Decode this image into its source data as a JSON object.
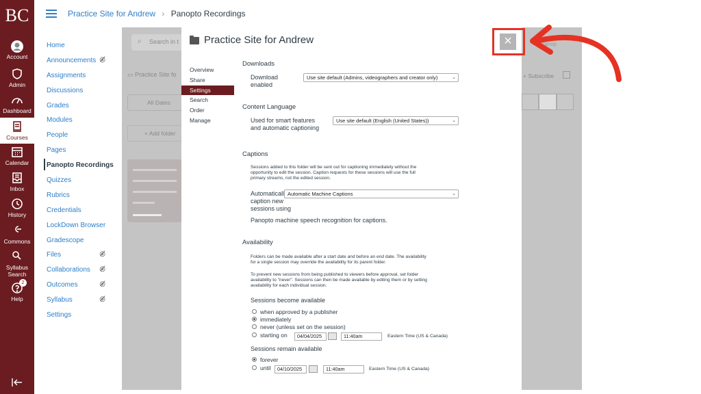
{
  "global_nav": {
    "logo": "BC",
    "items": [
      {
        "label": "Account",
        "icon": "account-icon"
      },
      {
        "label": "Admin",
        "icon": "admin-shield-icon"
      },
      {
        "label": "Dashboard",
        "icon": "dashboard-icon"
      },
      {
        "label": "Courses",
        "icon": "courses-icon"
      },
      {
        "label": "Calendar",
        "icon": "calendar-icon"
      },
      {
        "label": "Inbox",
        "icon": "inbox-icon"
      },
      {
        "label": "History",
        "icon": "history-clock-icon"
      },
      {
        "label": "Commons",
        "icon": "commons-icon"
      },
      {
        "label_line1": "Syllabus",
        "label_line2": "Search",
        "icon": "syllabus-search-icon"
      },
      {
        "label": "Help",
        "icon": "help-icon",
        "badge": "2"
      }
    ],
    "collapse_icon": "collapse-nav-icon"
  },
  "breadcrumb": {
    "course": "Practice Site for Andrew",
    "separator": "›",
    "current": "Panopto Recordings"
  },
  "course_nav": {
    "items": [
      {
        "label": "Home"
      },
      {
        "label": "Announcements",
        "hidden": true
      },
      {
        "label": "Assignments"
      },
      {
        "label": "Discussions"
      },
      {
        "label": "Grades"
      },
      {
        "label": "Modules"
      },
      {
        "label": "People"
      },
      {
        "label": "Pages"
      },
      {
        "label": "Panopto Recordings",
        "active": true
      },
      {
        "label": "Quizzes"
      },
      {
        "label": "Rubrics"
      },
      {
        "label": "Credentials"
      },
      {
        "label": "LockDown Browser"
      },
      {
        "label": "Gradescope"
      },
      {
        "label": "Files",
        "hidden": true
      },
      {
        "label": "Collaborations",
        "hidden": true
      },
      {
        "label": "Outcomes",
        "hidden": true
      },
      {
        "label": "Syllabus",
        "hidden": true
      },
      {
        "label": "Settings"
      }
    ]
  },
  "background": {
    "search_placeholder": "Search in t",
    "folder_label": "Practice Site fo",
    "dates_label": "All Dates",
    "add_folder": "Add folder",
    "subscribe": "Subscribe",
    "user_text": "Panop"
  },
  "modal": {
    "title": "Practice Site for Andrew",
    "close_symbol": "×",
    "nav": [
      "Overview",
      "Share",
      "Settings",
      "Search",
      "Order",
      "Manage"
    ],
    "active_nav": "Settings",
    "downloads": {
      "title": "Downloads",
      "label_line1": "Download",
      "label_line2": "enabled",
      "value": "Use site default (Admins, videographers and creator only)"
    },
    "content_language": {
      "title": "Content Language",
      "label_line1": "Used for smart features",
      "label_line2": "and automatic captioning",
      "value": "Use site default (English (United States))"
    },
    "captions": {
      "title": "Captions",
      "description_line1": "Sessions added to this folder will be sent out for captioning immediately without the",
      "description_line2": "opportunity to edit the session. Caption requests for these sessions will use the full",
      "description_line3": "primary streams, not the edited session.",
      "label_line1": "Automatically",
      "label_line2": "caption new",
      "label_line3": "sessions using",
      "value": "Automatic Machine Captions",
      "note": "Panopto machine speech recognition for captions."
    },
    "availability": {
      "title": "Availability",
      "p1_line1": "Folders can be made available after a start date and before an end date. The availability",
      "p1_line2": "for a single session may override the availability for its parent folder.",
      "p2_line1": "To prevent new sessions from being published to viewers before approval, set folder",
      "p2_line2": "availability to \"never\". Sessions can then be made available by editing them or by setting",
      "p2_line3": "availability for each individual session.",
      "become_title": "Sessions become available",
      "become_options": [
        {
          "label": "when approved by a publisher",
          "selected": false
        },
        {
          "label": "immediately",
          "selected": true
        },
        {
          "label": "never (unless set on the session)",
          "selected": false
        },
        {
          "label": "starting on",
          "selected": false
        }
      ],
      "start_date": "04/04/2025",
      "start_time": "11:40am",
      "timezone": "Eastern Time (US & Canada)",
      "remain_title": "Sessions remain available",
      "remain_options": [
        {
          "label": "forever",
          "selected": true
        },
        {
          "label": "until",
          "selected": false
        }
      ],
      "end_date": "04/10/2025",
      "end_time": "11:40am"
    }
  },
  "colors": {
    "brand": "#6b1c20",
    "link": "#2d7ec8",
    "annotation": "#e63223"
  }
}
